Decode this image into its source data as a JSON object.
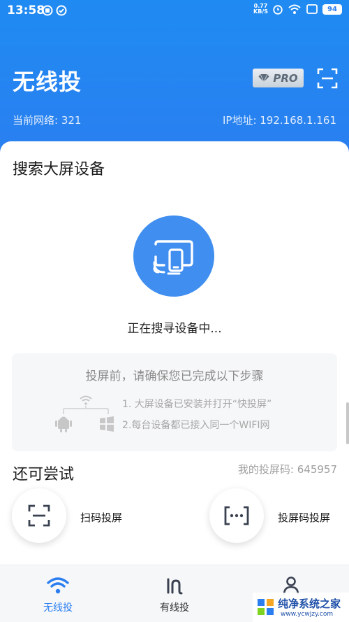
{
  "status_bar": {
    "time": "13:58",
    "net_speed_value": "0.77",
    "net_speed_unit": "KB/S",
    "battery": "94"
  },
  "header": {
    "title": "无线投",
    "pro_badge": "PRO",
    "network": "当前网络: 321",
    "ip": "IP地址: 192.168.1.161"
  },
  "search": {
    "title": "搜索大屏设备",
    "status": "正在搜寻设备中..."
  },
  "tips": {
    "title": "投屏前，请确保您已完成以下步骤",
    "step1": "1. 大屏设备已安装并打开“快投屏”",
    "step2": "2.每台设备都已接入同一个WIFI网"
  },
  "try": {
    "title": "还可尝试",
    "cast_code": "我的投屏码: 645957",
    "options": [
      {
        "label": "扫码投屏",
        "icon": "scan-icon"
      },
      {
        "label": "投屏码投屏",
        "icon": "code-dots-icon"
      }
    ]
  },
  "nav": {
    "items": [
      {
        "label": "无线投",
        "icon": "wifi-icon",
        "active": true
      },
      {
        "label": "有线投",
        "icon": "cable-icon",
        "active": false
      },
      {
        "label": "",
        "icon": "person-icon",
        "active": false
      }
    ]
  },
  "watermark": {
    "title": "纯净系统之家",
    "url": "www.ycwjzy.com"
  },
  "colors": {
    "brand_blue": "#2b7ef0",
    "circle_blue": "#3f8ef0",
    "card_bg": "#ffffff",
    "tips_bg": "#f6f7f9"
  }
}
